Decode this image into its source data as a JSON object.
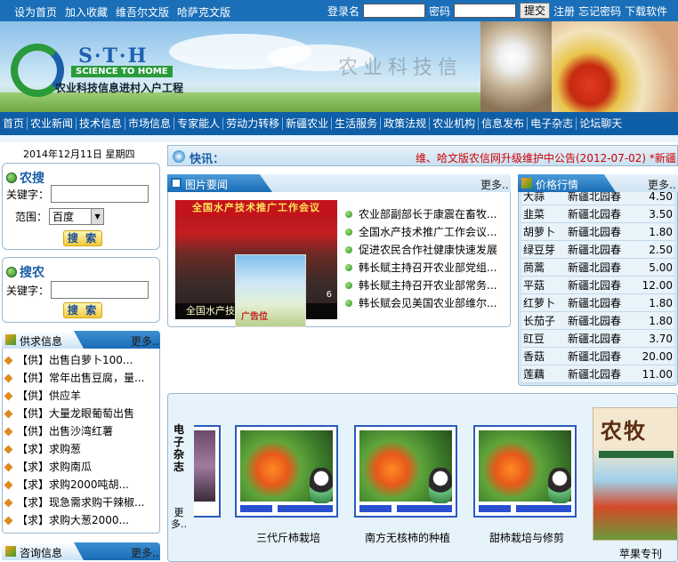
{
  "topbar": {
    "links": [
      "设为首页",
      "加入收藏",
      "维吾尔文版",
      "哈萨克文版"
    ],
    "username_label": "登录名",
    "password_label": "密码",
    "submit_label": "提交",
    "register_label": "注册",
    "forgot_label": "忘记密码",
    "download_label": "下载软件"
  },
  "banner": {
    "logo_letters": "S·T·H",
    "logo_sub": "SCIENCE TO HOME",
    "logo_title": "农业科技信息进村入户工程"
  },
  "nav": [
    "首页",
    "农业新闻",
    "技术信息",
    "市场信息",
    "专家能人",
    "劳动力转移",
    "新疆农业",
    "生活服务",
    "政策法规",
    "农业机构",
    "信息发布",
    "电子杂志",
    "论坛聊天"
  ],
  "date": "2014年12月11日  星期四",
  "search1": {
    "title": "农搜",
    "keyword_label": "关键字：",
    "scope_label": "范围：",
    "scope_value": "百度",
    "button": "搜 索"
  },
  "search2": {
    "title": "搜农",
    "keyword_label": "关键字：",
    "button": "搜 索"
  },
  "supply": {
    "title": "供求信息",
    "more": "更多..",
    "items": [
      "【供】出售白萝卜100...",
      "【供】常年出售豆腐，量...",
      "【供】供应羊",
      "【供】大量龙眼葡萄出售",
      "【供】出售沙湾红薯",
      "【求】求购葱",
      "【求】求购南瓜",
      "【求】求购2000吨胡...",
      "【求】现急需求购干辣椒...",
      "【求】求购大葱2000..."
    ]
  },
  "consult": {
    "title": "咨询信息",
    "more": "更多.."
  },
  "kuaixun": {
    "title": "快讯：",
    "message": "维、哈文版农信网升级维护中公告(2012-07-02) *新疆"
  },
  "picnews": {
    "title": "图片要闻",
    "more": "更多..",
    "photo_banner": "全国水产技术推广工作会议",
    "photo_caption": "全国水产技...议...",
    "photo_page": "6",
    "ad_text": "广告位",
    "items": [
      "农业部副部长于康震在畜牧...",
      "全国水产技术推广工作会议...",
      "促进农民合作社健康快速发展",
      "韩长赋主持召开农业部党组...",
      "韩长赋主持召开农业部常务...",
      "韩长赋会见美国农业部维尔..."
    ]
  },
  "prices": {
    "title": "价格行情",
    "more": "更多..",
    "rows": [
      {
        "name": "大蒜",
        "market": "新疆北园春",
        "price": "4.50"
      },
      {
        "name": "韭菜",
        "market": "新疆北园春",
        "price": "3.50"
      },
      {
        "name": "胡萝卜",
        "market": "新疆北园春",
        "price": "1.80"
      },
      {
        "name": "绿豆芽",
        "market": "新疆北园春",
        "price": "2.50"
      },
      {
        "name": "茼蒿",
        "market": "新疆北园春",
        "price": "5.00"
      },
      {
        "name": "平菇",
        "market": "新疆北园春",
        "price": "12.00"
      },
      {
        "name": "红萝卜",
        "market": "新疆北园春",
        "price": "1.80"
      },
      {
        "name": "长茄子",
        "market": "新疆北园春",
        "price": "1.80"
      },
      {
        "name": "豇豆",
        "market": "新疆北园春",
        "price": "3.70"
      },
      {
        "name": "香菇",
        "market": "新疆北园春",
        "price": "20.00"
      },
      {
        "name": "莲藕",
        "market": "新疆北园春",
        "price": "11.00"
      }
    ]
  },
  "magazine": {
    "side_title": "电子杂志",
    "more": "更多..",
    "cards": [
      "三代斤柿栽培",
      "南方无核柿的种植",
      "甜柿栽培与修剪"
    ],
    "cover_title": "农牧",
    "cover_label": "苹果专刊"
  }
}
